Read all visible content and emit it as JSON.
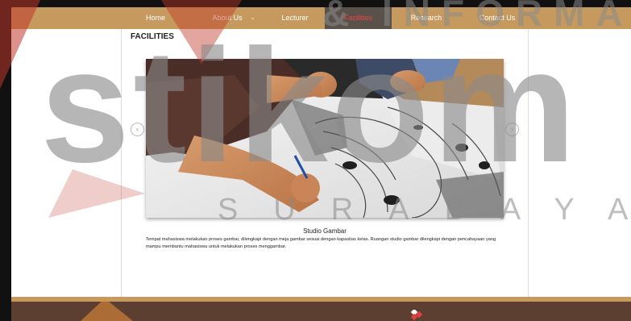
{
  "nav": {
    "items": [
      {
        "label": "Home"
      },
      {
        "label": "About Us"
      },
      {
        "label": "Lecturer"
      },
      {
        "label": "Facilities"
      },
      {
        "label": "Research"
      },
      {
        "label": "Contact Us"
      }
    ],
    "active": "Facilities",
    "caret_glyph": "⌄"
  },
  "page": {
    "title": "FACILITIES"
  },
  "slider": {
    "prev_glyph": "‹",
    "next_glyph": "›",
    "caption_title": "Studio Gambar",
    "caption_desc": "Tempat mahasiswa melakukan proses gambar, dilengkapi dengan meja gambar sesuai dengan kapasitas kelas. Ruangan studio gambar dilengkapi dengan pencahayaan yang mampu membantu  mahasiswa untuk melakukan proses menggambar."
  },
  "watermark": {
    "line1": "& INFORMATI",
    "word": "stikom",
    "line3": "SURABAYA"
  },
  "colors": {
    "nav_bg": "#c69a5e",
    "nav_active_bg": "#5a514a",
    "nav_active_text": "#e44444",
    "footer_bg": "#5c3f31",
    "watermark_red": "#c0392b",
    "watermark_gray": "#8a8a8a"
  }
}
